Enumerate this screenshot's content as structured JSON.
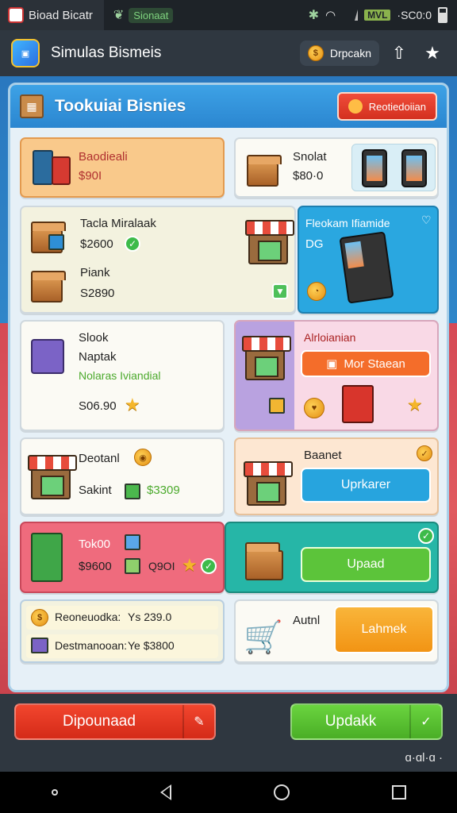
{
  "status_bar": {
    "tab1_label": "Bioad Bicatr",
    "tab2_label": "Sionaat",
    "carrier": "MVL",
    "time": "·SC0:0",
    "icons": [
      "settings-icon",
      "wifi-icon",
      "signal-icon",
      "battery-icon"
    ]
  },
  "app_bar": {
    "title": "Simulas Bismeis",
    "currency_label": "Drpcakn",
    "icons": [
      "app-logo-icon",
      "coin-icon",
      "share-icon",
      "star-icon"
    ]
  },
  "panel": {
    "title": "Tookuiai Bisnies",
    "header_button": "Reotiedoiian"
  },
  "cards": {
    "c1": {
      "name": "Baodieali",
      "price": "$90I"
    },
    "c2": {
      "name": "Snolat",
      "price": "$80·0"
    },
    "c3": {
      "name1": "Tacla Miralaak",
      "price1": "$2600",
      "name2": "Piank",
      "price2": "S2890"
    },
    "c4": {
      "name": "Fleokam Ifiamide",
      "code": "DG"
    },
    "c5": {
      "line1": "Slook",
      "line2": "Naptak",
      "subtitle": "Nolaras Iviandial",
      "price": "S06.90"
    },
    "c6": {
      "name": "Alrloianian",
      "button": "Mor Staean"
    },
    "c7": {
      "name": "Deotanl",
      "sub": "Sakint",
      "price": "$3309"
    },
    "c8": {
      "name": "Baanet",
      "button": "Uprkarer"
    },
    "c9": {
      "name": "Tok00",
      "price": "$9600",
      "code": "Q9OI"
    },
    "c10": {
      "button": "Upaad"
    },
    "c11": {
      "row1_label": "Reoneuodka:",
      "row1_value": "Ys 239.0",
      "row2_label": "Destmanooan:",
      "row2_value": "Ye $3800"
    },
    "c12": {
      "name": "Autnl",
      "button": "Lahmek"
    }
  },
  "action_bar": {
    "left_button": "Dipounaad",
    "right_button": "Updakk",
    "footer": "ɑ·ɑl·ɑ ·"
  },
  "colors": {
    "accent_blue": "#2b86d0",
    "accent_red": "#e2402f",
    "accent_green": "#5cc43a",
    "accent_orange": "#f7a12a",
    "price_green": "#4caa2d"
  }
}
